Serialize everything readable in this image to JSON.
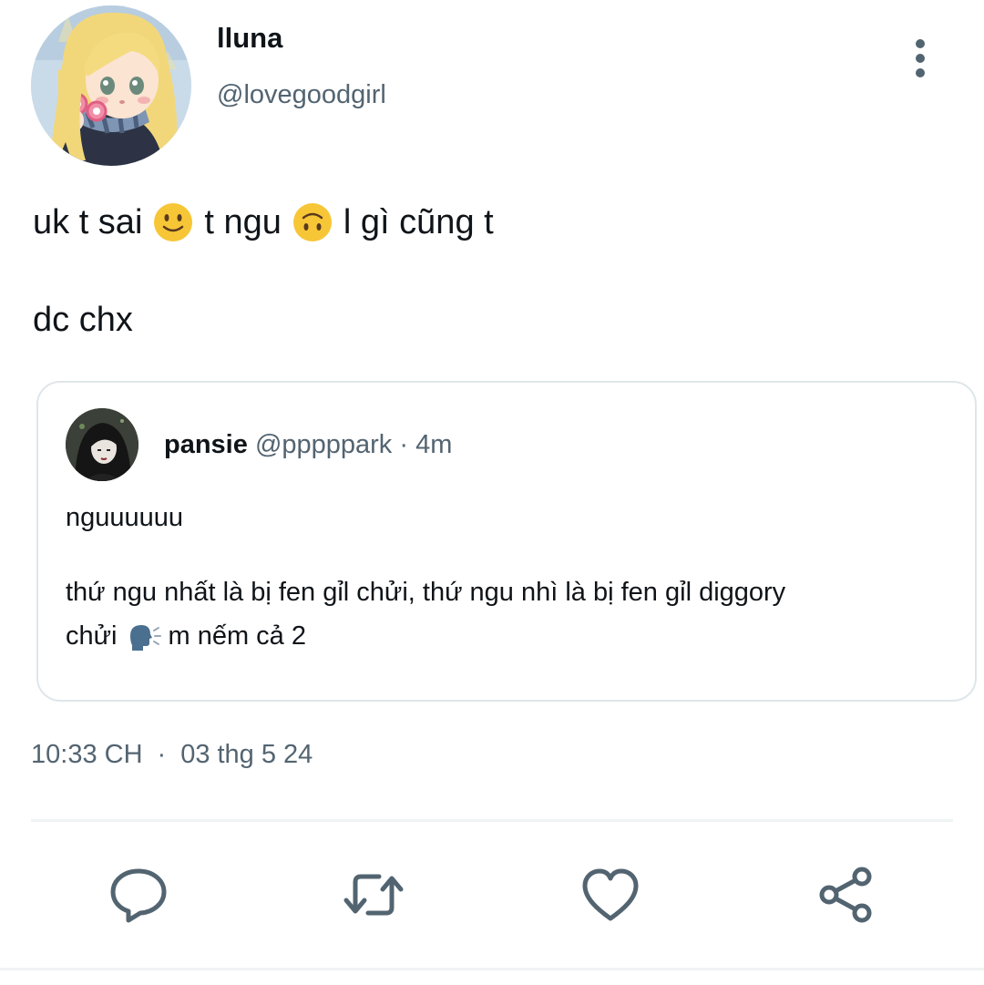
{
  "author": {
    "display_name": "lluna",
    "handle": "@lovegoodgirl"
  },
  "post": {
    "line1_part1": "uk t sai",
    "emoji1": "slightly-smiling-face-emoji",
    "line1_part2": "t ngu",
    "emoji2": "upside-down-face-emoji",
    "line1_part3": "l gì cũng t",
    "line2": "dc chx"
  },
  "quote": {
    "name": "pansie",
    "handle": "@pppppark",
    "separator": "·",
    "time": "4m",
    "line1": "nguuuuuu",
    "line2": "thứ ngu nhất là bị fen gỉl chửi, thứ ngu nhì là bị fen gỉl diggory",
    "line3_part1": "chửi",
    "line3_emoji": "speaking-head-emoji",
    "line3_part2": "m nếm cả 2"
  },
  "timestamp": {
    "time": "10:33 CH",
    "separator": "·",
    "date": "03 thg 5 24"
  },
  "actions": {
    "reply_icon": "reply-icon",
    "retweet_icon": "retweet-icon",
    "like_icon": "heart-icon",
    "share_icon": "share-icon"
  },
  "colors": {
    "text_primary": "#0f1419",
    "text_secondary": "#536471",
    "border": "#dfe6ea",
    "emoji_yellow": "#f7c637"
  }
}
